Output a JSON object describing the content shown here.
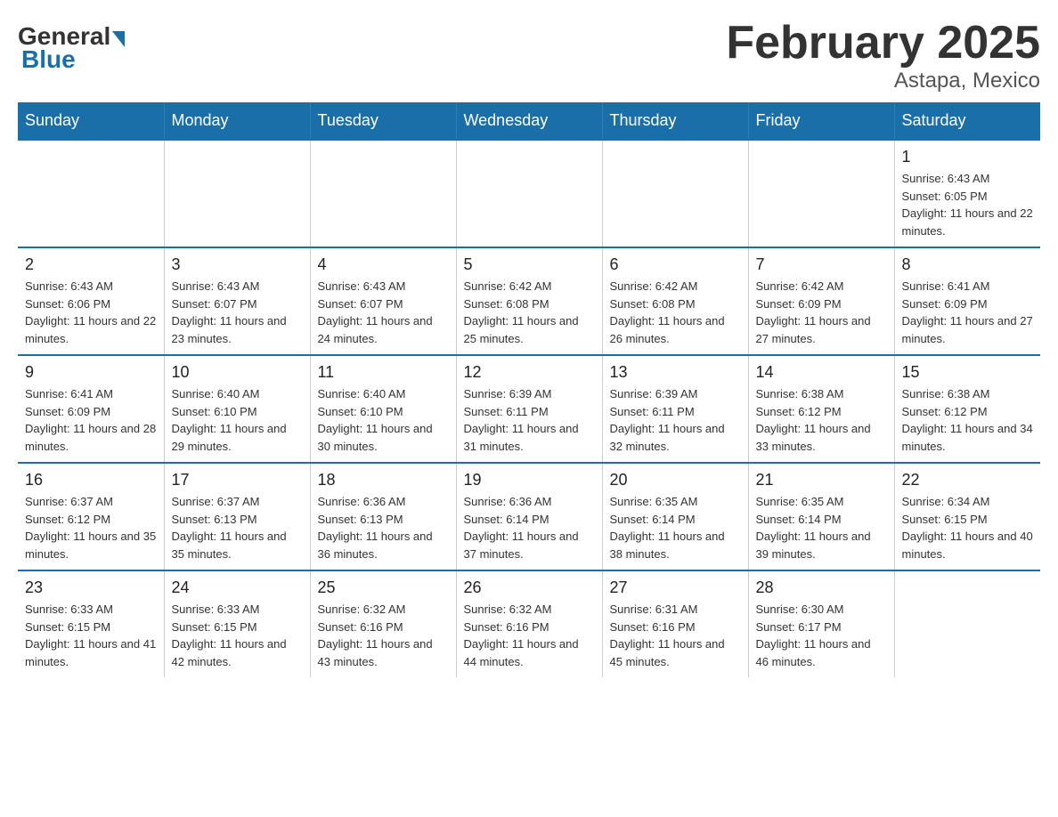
{
  "logo": {
    "general": "General",
    "blue": "Blue"
  },
  "title": "February 2025",
  "subtitle": "Astapa, Mexico",
  "days_header": [
    "Sunday",
    "Monday",
    "Tuesday",
    "Wednesday",
    "Thursday",
    "Friday",
    "Saturday"
  ],
  "weeks": [
    [
      {
        "day": "",
        "info": ""
      },
      {
        "day": "",
        "info": ""
      },
      {
        "day": "",
        "info": ""
      },
      {
        "day": "",
        "info": ""
      },
      {
        "day": "",
        "info": ""
      },
      {
        "day": "",
        "info": ""
      },
      {
        "day": "1",
        "info": "Sunrise: 6:43 AM\nSunset: 6:05 PM\nDaylight: 11 hours and 22 minutes."
      }
    ],
    [
      {
        "day": "2",
        "info": "Sunrise: 6:43 AM\nSunset: 6:06 PM\nDaylight: 11 hours and 22 minutes."
      },
      {
        "day": "3",
        "info": "Sunrise: 6:43 AM\nSunset: 6:07 PM\nDaylight: 11 hours and 23 minutes."
      },
      {
        "day": "4",
        "info": "Sunrise: 6:43 AM\nSunset: 6:07 PM\nDaylight: 11 hours and 24 minutes."
      },
      {
        "day": "5",
        "info": "Sunrise: 6:42 AM\nSunset: 6:08 PM\nDaylight: 11 hours and 25 minutes."
      },
      {
        "day": "6",
        "info": "Sunrise: 6:42 AM\nSunset: 6:08 PM\nDaylight: 11 hours and 26 minutes."
      },
      {
        "day": "7",
        "info": "Sunrise: 6:42 AM\nSunset: 6:09 PM\nDaylight: 11 hours and 27 minutes."
      },
      {
        "day": "8",
        "info": "Sunrise: 6:41 AM\nSunset: 6:09 PM\nDaylight: 11 hours and 27 minutes."
      }
    ],
    [
      {
        "day": "9",
        "info": "Sunrise: 6:41 AM\nSunset: 6:09 PM\nDaylight: 11 hours and 28 minutes."
      },
      {
        "day": "10",
        "info": "Sunrise: 6:40 AM\nSunset: 6:10 PM\nDaylight: 11 hours and 29 minutes."
      },
      {
        "day": "11",
        "info": "Sunrise: 6:40 AM\nSunset: 6:10 PM\nDaylight: 11 hours and 30 minutes."
      },
      {
        "day": "12",
        "info": "Sunrise: 6:39 AM\nSunset: 6:11 PM\nDaylight: 11 hours and 31 minutes."
      },
      {
        "day": "13",
        "info": "Sunrise: 6:39 AM\nSunset: 6:11 PM\nDaylight: 11 hours and 32 minutes."
      },
      {
        "day": "14",
        "info": "Sunrise: 6:38 AM\nSunset: 6:12 PM\nDaylight: 11 hours and 33 minutes."
      },
      {
        "day": "15",
        "info": "Sunrise: 6:38 AM\nSunset: 6:12 PM\nDaylight: 11 hours and 34 minutes."
      }
    ],
    [
      {
        "day": "16",
        "info": "Sunrise: 6:37 AM\nSunset: 6:12 PM\nDaylight: 11 hours and 35 minutes."
      },
      {
        "day": "17",
        "info": "Sunrise: 6:37 AM\nSunset: 6:13 PM\nDaylight: 11 hours and 35 minutes."
      },
      {
        "day": "18",
        "info": "Sunrise: 6:36 AM\nSunset: 6:13 PM\nDaylight: 11 hours and 36 minutes."
      },
      {
        "day": "19",
        "info": "Sunrise: 6:36 AM\nSunset: 6:14 PM\nDaylight: 11 hours and 37 minutes."
      },
      {
        "day": "20",
        "info": "Sunrise: 6:35 AM\nSunset: 6:14 PM\nDaylight: 11 hours and 38 minutes."
      },
      {
        "day": "21",
        "info": "Sunrise: 6:35 AM\nSunset: 6:14 PM\nDaylight: 11 hours and 39 minutes."
      },
      {
        "day": "22",
        "info": "Sunrise: 6:34 AM\nSunset: 6:15 PM\nDaylight: 11 hours and 40 minutes."
      }
    ],
    [
      {
        "day": "23",
        "info": "Sunrise: 6:33 AM\nSunset: 6:15 PM\nDaylight: 11 hours and 41 minutes."
      },
      {
        "day": "24",
        "info": "Sunrise: 6:33 AM\nSunset: 6:15 PM\nDaylight: 11 hours and 42 minutes."
      },
      {
        "day": "25",
        "info": "Sunrise: 6:32 AM\nSunset: 6:16 PM\nDaylight: 11 hours and 43 minutes."
      },
      {
        "day": "26",
        "info": "Sunrise: 6:32 AM\nSunset: 6:16 PM\nDaylight: 11 hours and 44 minutes."
      },
      {
        "day": "27",
        "info": "Sunrise: 6:31 AM\nSunset: 6:16 PM\nDaylight: 11 hours and 45 minutes."
      },
      {
        "day": "28",
        "info": "Sunrise: 6:30 AM\nSunset: 6:17 PM\nDaylight: 11 hours and 46 minutes."
      },
      {
        "day": "",
        "info": ""
      }
    ]
  ]
}
